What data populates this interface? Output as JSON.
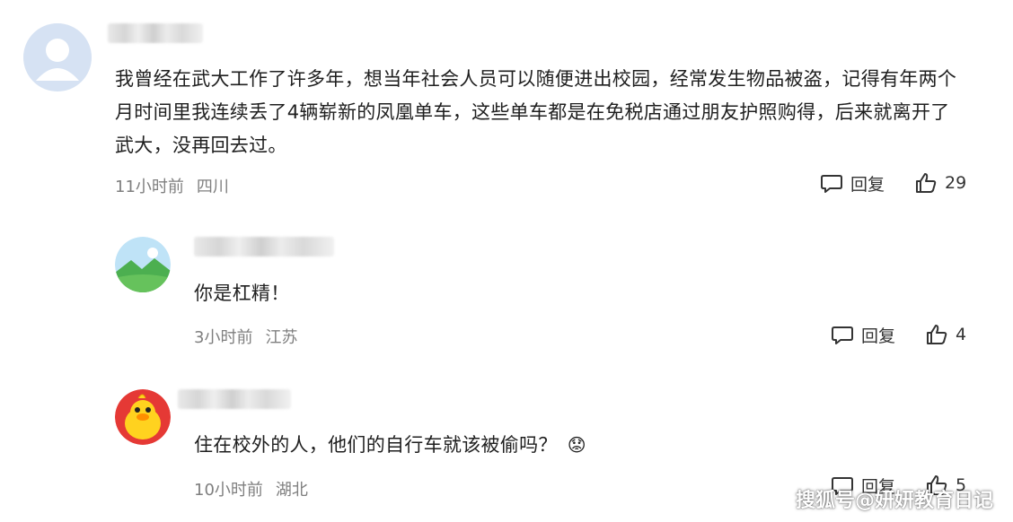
{
  "comments": [
    {
      "text": "我曾经在武大工作了许多年，想当年社会人员可以随便进出校园，经常发生物品被盗，记得有年两个月时间里我连续丢了4辆崭新的凤凰单车，这些单车都是在免税店通过朋友护照购得，后来就离开了武大，没再回去过。",
      "time": "11小时前",
      "location": "四川",
      "reply_label": "回复",
      "likes": "29"
    },
    {
      "text": "你是杠精！",
      "time": "3小时前",
      "location": "江苏",
      "reply_label": "回复",
      "likes": "4"
    },
    {
      "text": "住在校外的人，他们的自行车就该被偷吗？",
      "emoji": "😟",
      "time": "10小时前",
      "location": "湖北",
      "reply_label": "回复",
      "likes": "5"
    }
  ],
  "watermark": "搜狐号@妍妍教育日记"
}
